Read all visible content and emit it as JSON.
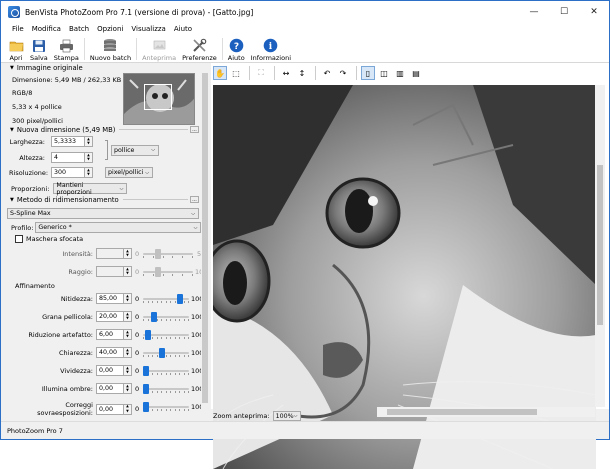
{
  "window": {
    "title": "BenVista PhotoZoom Pro 7.1 (versione di prova) - [Gatto.jpg]",
    "minimize": "—",
    "maximize": "☐",
    "close": "✕"
  },
  "menu": [
    "File",
    "Modifica",
    "Batch",
    "Opzioni",
    "Visualizza",
    "Aiuto"
  ],
  "toolbar": {
    "open": "Apri",
    "save": "Salva",
    "print": "Stampa",
    "new_batch": "Nuovo batch",
    "preview": "Anteprima",
    "preferences": "Preferenze",
    "help": "Aiuto",
    "info": "Informazioni"
  },
  "original": {
    "header": "Immagine originale",
    "dimension": "Dimensione: 5,49 MB / 262,33 KB",
    "mode": "RGB/8",
    "size": "5,33 x 4 pollice",
    "resolution": "300 pixel/pollici"
  },
  "new_size": {
    "header": "Nuova dimensione (5,49 MB)",
    "width_label": "Larghezza:",
    "width_value": "5,3333",
    "height_label": "Altezza:",
    "height_value": "4",
    "unit": "pollice",
    "resolution_label": "Risoluzione:",
    "resolution_value": "300",
    "resolution_unit": "pixel/pollici",
    "proportions_label": "Proporzioni:",
    "proportions_value": "Mantieni proporzioni"
  },
  "method": {
    "header": "Metodo di ridimensionamento",
    "algorithm": "S-Spline Max",
    "profile_label": "Profilo:",
    "profile_value": "Generico *",
    "mask_label": "Maschera sfocata",
    "intensity_label": "Intensità:",
    "intensity_min": "0",
    "intensity_max": "5",
    "radius_label": "Raggio:",
    "radius_min": "0",
    "radius_max": "10"
  },
  "sharpening": {
    "header": "Affinamento",
    "min": "0",
    "max": "100",
    "rows": [
      {
        "label": "Nitidezza:",
        "value": "85,00",
        "level": 85
      },
      {
        "label": "Grana pellicola:",
        "value": "20,00",
        "level": 20
      },
      {
        "label": "Riduzione artefatto:",
        "value": "6,00",
        "level": 6
      },
      {
        "label": "Chiarezza:",
        "value": "40,00",
        "level": 40
      },
      {
        "label": "Vividezza:",
        "value": "0,00",
        "level": 0
      },
      {
        "label": "Illumina ombre:",
        "value": "0,00",
        "level": 0
      },
      {
        "label": "Correggi sovraesposizioni:",
        "value": "0,00",
        "level": 0
      }
    ]
  },
  "zoom": {
    "label": "Zoom anteprima:",
    "value": "100%"
  },
  "status": "PhotoZoom Pro 7",
  "colors": {
    "accent": "#1a73d9",
    "help_icon": "#1b5fbf"
  }
}
